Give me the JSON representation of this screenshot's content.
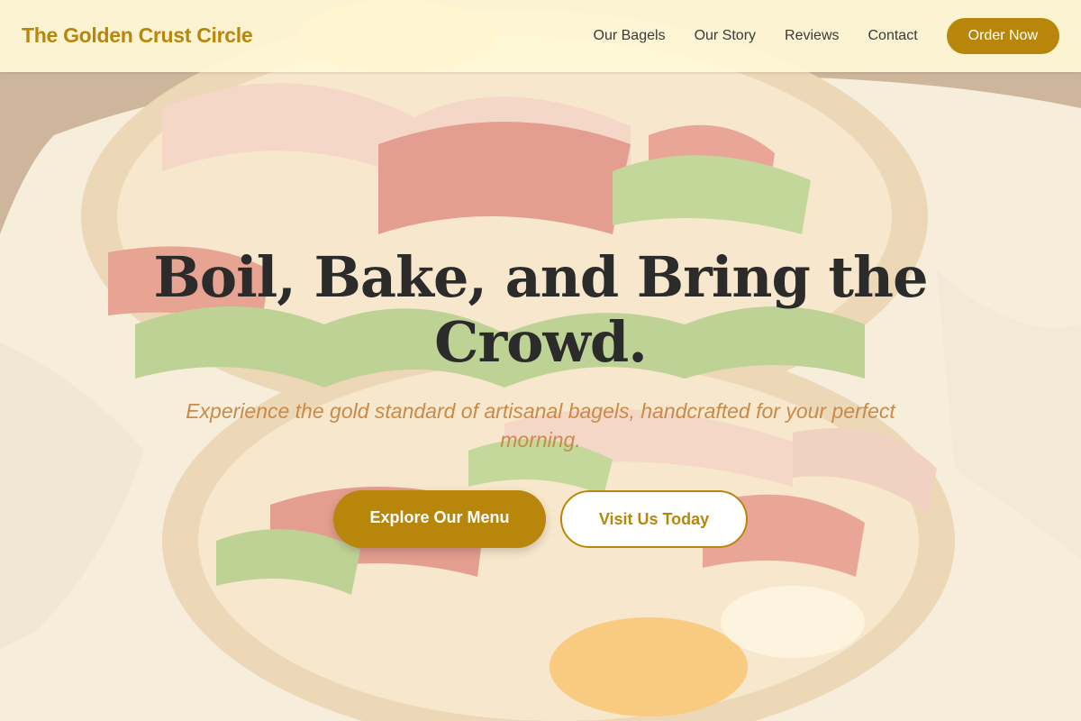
{
  "header": {
    "brand": "The Golden Crust Circle",
    "nav": [
      {
        "label": "Our Bagels"
      },
      {
        "label": "Our Story"
      },
      {
        "label": "Reviews"
      },
      {
        "label": "Contact"
      }
    ],
    "order_button": "Order Now"
  },
  "hero": {
    "title": "Boil, Bake, and Bring the Crowd.",
    "subtitle": "Experience the gold standard of artisanal bagels, handcrafted for your perfect morning.",
    "primary_button": "Explore Our Menu",
    "secondary_button": "Visit Us Today",
    "background_image": "bagel-sandwich-photo"
  },
  "colors": {
    "accent": "#b8860b",
    "header_bg": "#fff7d6",
    "title": "#2b2b2b",
    "subtitle": "#c98a4a"
  }
}
